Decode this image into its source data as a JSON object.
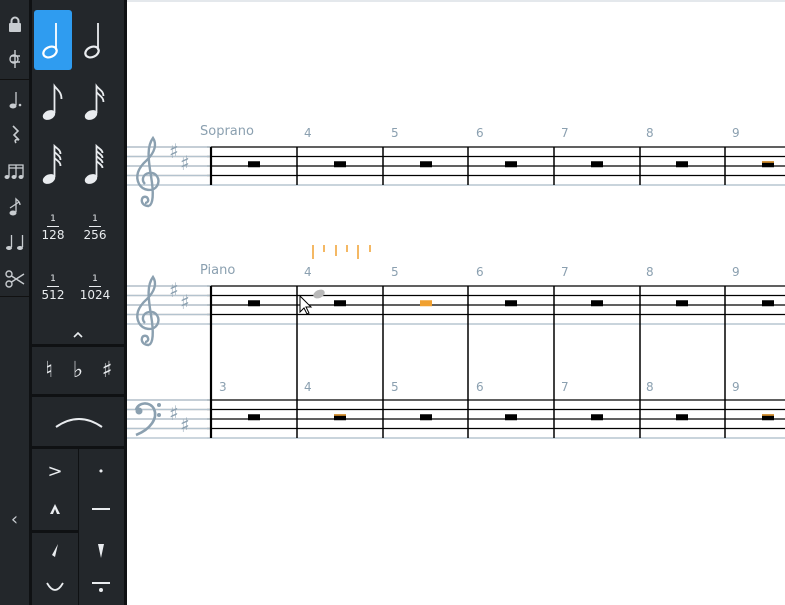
{
  "left_toolbar": {
    "icons": [
      "lock-icon",
      "treble-clef-key-icon",
      "dotted-note-icon",
      "rest-icon",
      "beamed-notes-icon",
      "grace-note-icon",
      "tie-notes-icon",
      "scissors-icon"
    ],
    "collapse_glyph": "‹"
  },
  "note_panel": {
    "durations": [
      "half-note",
      "quarter-note",
      "eighth-note",
      "sixteenth-note",
      "thirty-second-note",
      "sixty-fourth-note"
    ],
    "selected": "half-note",
    "fractions": [
      {
        "num": "1",
        "den": "128"
      },
      {
        "num": "1",
        "den": "256"
      },
      {
        "num": "1",
        "den": "512"
      },
      {
        "num": "1",
        "den": "1024"
      }
    ],
    "expand_glyph": "^",
    "accidentals": [
      "♮",
      "♭",
      "♯"
    ],
    "articulations": [
      ">",
      "•",
      "^",
      "—",
      "'",
      "'",
      "◡",
      "—"
    ]
  },
  "score": {
    "soprano_label": "Soprano",
    "piano_label": "Piano",
    "measure_numbers_top": [
      "4",
      "5",
      "6",
      "7",
      "8",
      "9"
    ],
    "measure_numbers_bass": [
      "3",
      "4",
      "5",
      "6",
      "7",
      "8",
      "9"
    ],
    "colors": {
      "staff": "#000000",
      "clef": "#8ba0b0",
      "highlight": "#f0a030",
      "ghost": "#b8b8b8"
    }
  }
}
